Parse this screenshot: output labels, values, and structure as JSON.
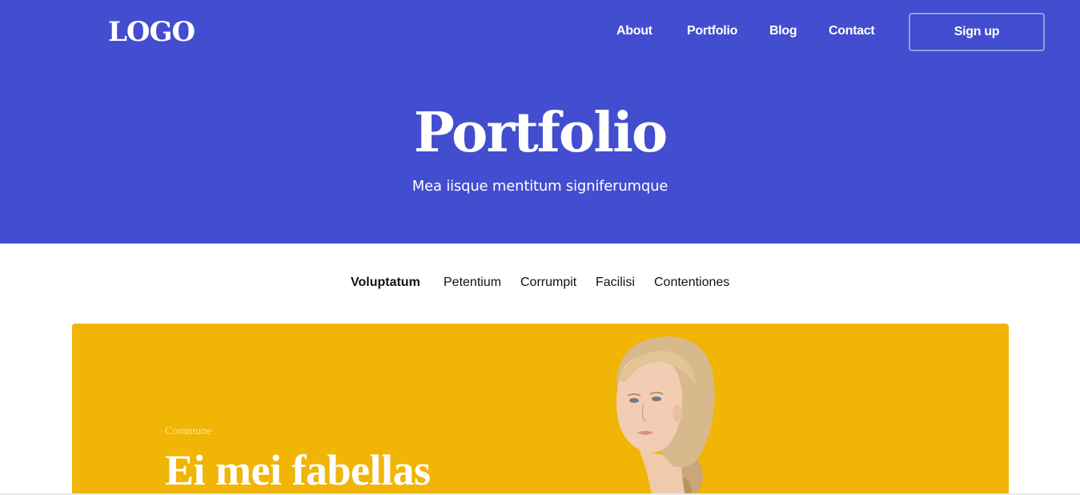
{
  "brand": {
    "logo": "LOGO"
  },
  "nav": {
    "items": [
      {
        "label": "About"
      },
      {
        "label": "Portfolio"
      },
      {
        "label": "Blog"
      },
      {
        "label": "Contact"
      }
    ],
    "signup_label": "Sign up"
  },
  "hero": {
    "title": "Portfolio",
    "subtitle": "Mea iisque mentitum signiferumque"
  },
  "tabs": [
    {
      "label": "Voluptatum",
      "active": true
    },
    {
      "label": "Petentium",
      "active": false
    },
    {
      "label": "Corrumpit",
      "active": false
    },
    {
      "label": "Facilisi",
      "active": false
    },
    {
      "label": "Contentiones",
      "active": false
    }
  ],
  "card": {
    "eyebrow": "Commune",
    "title": "Ei mei fabellas",
    "image": "portrait-photo"
  },
  "colors": {
    "hero_bg": "#434dcf",
    "card_bg": "#f0b505",
    "text_on_brand": "#ffffff"
  }
}
